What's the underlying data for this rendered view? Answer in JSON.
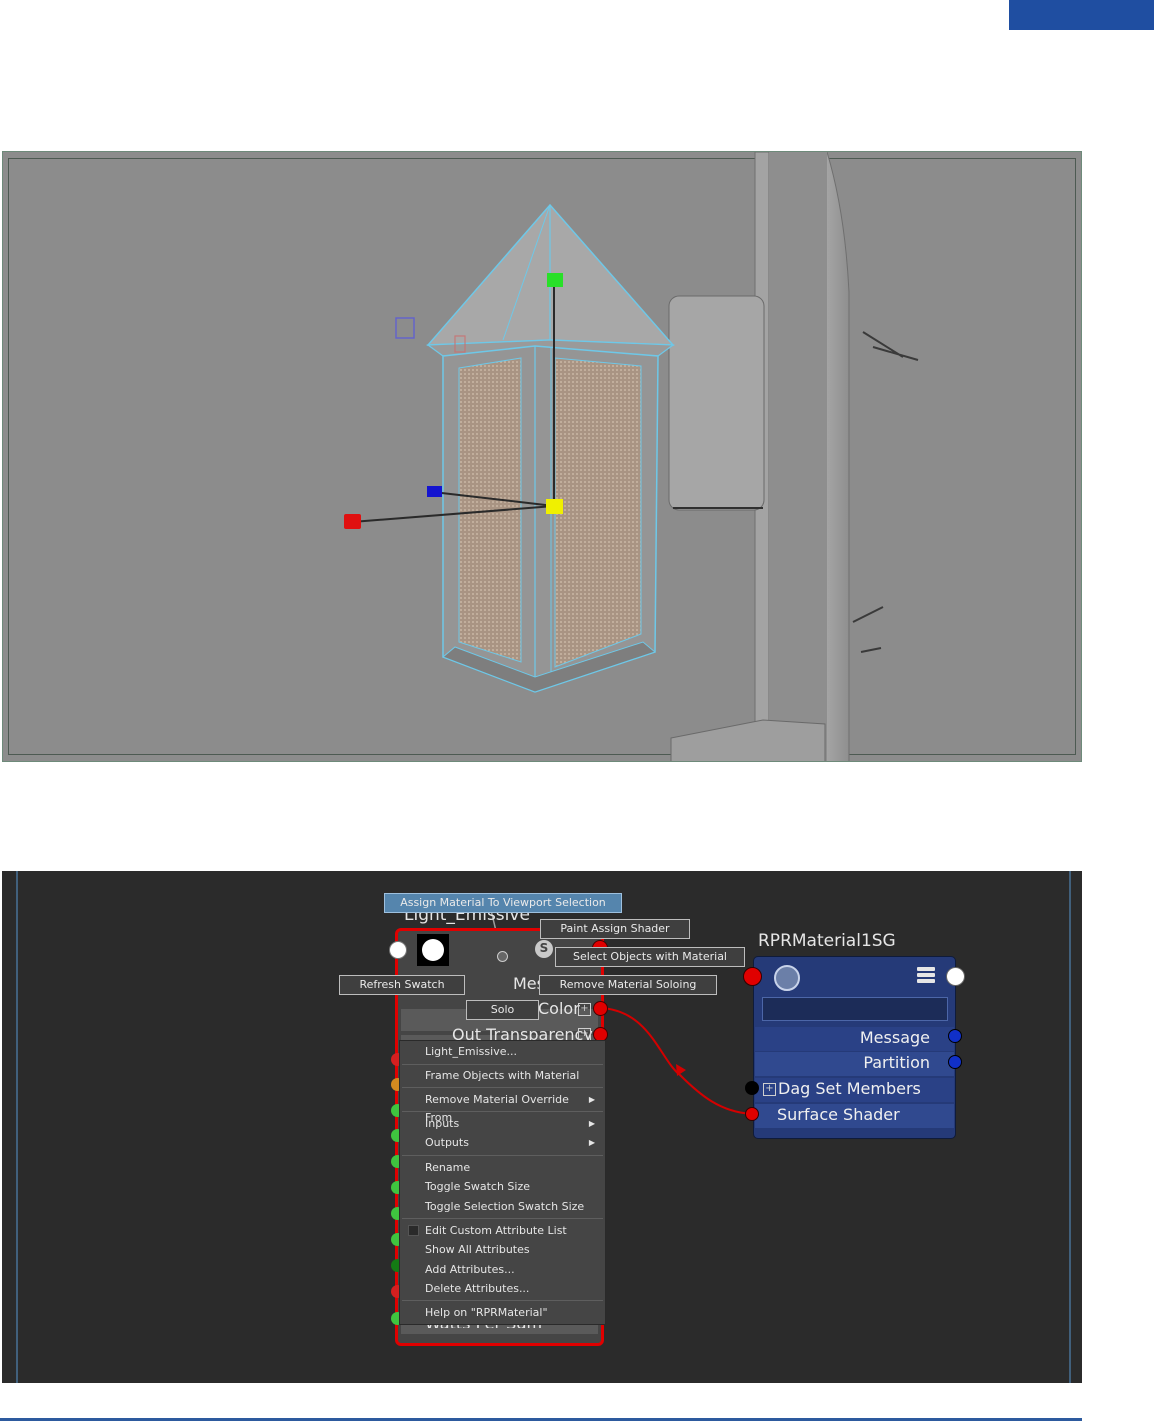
{
  "material_node": {
    "title": "Light_Emissive",
    "message_label": "Mes",
    "color_label": "Color",
    "out_transparency_label": "Out Transparency",
    "watts_label": "Watts Per Sqm"
  },
  "shading_group_node": {
    "title": "RPRMaterial1SG",
    "attributes": [
      "Message",
      "Partition",
      "Dag Set Members",
      "Surface Shader"
    ]
  },
  "radial_menu": {
    "assign_material": "Assign Material To Viewport Selection",
    "paint_assign": "Paint Assign Shader",
    "select_objects": "Select Objects with Material",
    "refresh_swatch": "Refresh Swatch",
    "remove_soloing": "Remove Material Soloing",
    "solo": "Solo",
    "solo_badge": "S"
  },
  "context_menu": {
    "items": [
      "Light_Emissive...",
      "Frame Objects with Material",
      "Remove Material Override From",
      "Inputs",
      "Outputs",
      "Rename",
      "Toggle Swatch Size",
      "Toggle Selection Swatch Size",
      "Edit Custom Attribute List",
      "Show All Attributes",
      "Add Attributes...",
      "Delete Attributes...",
      "Help on \"RPRMaterial\""
    ]
  },
  "colors": {
    "header_accent": "#1f4ea1",
    "node_selected_outline": "#e00000",
    "shading_group_body": "#253a78",
    "wireframe_highlight": "#6ec8e8",
    "connection_wire": "#d40000"
  },
  "icons": {
    "swatch": "material-swatch-icon",
    "shading_group": "shading-group-icon",
    "list": "attribute-list-icon"
  }
}
